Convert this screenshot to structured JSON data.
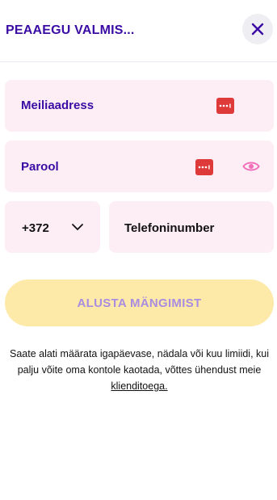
{
  "header": {
    "title": "PEAAEGU VALMIS...",
    "close_icon": "close-icon"
  },
  "form": {
    "email": {
      "label": "Meiliaadress",
      "icon": "password-manager-icon"
    },
    "password": {
      "label": "Parool",
      "icon": "password-manager-icon",
      "toggle_icon": "eye-icon"
    },
    "phone": {
      "prefix": "+372",
      "prefix_icon": "chevron-down-icon",
      "placeholder": "Telefoninumber"
    }
  },
  "cta": {
    "label": "ALUSTA MÄNGIMIST",
    "state": "disabled"
  },
  "info": {
    "text": "Saate alati määrata igapäevase, nädala või kuu limiidi, kui palju võite oma kontole kaotada, võttes ühendust meie",
    "link": "klienditoega."
  },
  "colors": {
    "accent": "#3a0ca3",
    "field_bg": "#fdeef6",
    "cta_bg": "#fde9a8",
    "cta_text": "#a98de0",
    "pw_manager": "#df3a3a",
    "eye": "#f06fb8"
  }
}
